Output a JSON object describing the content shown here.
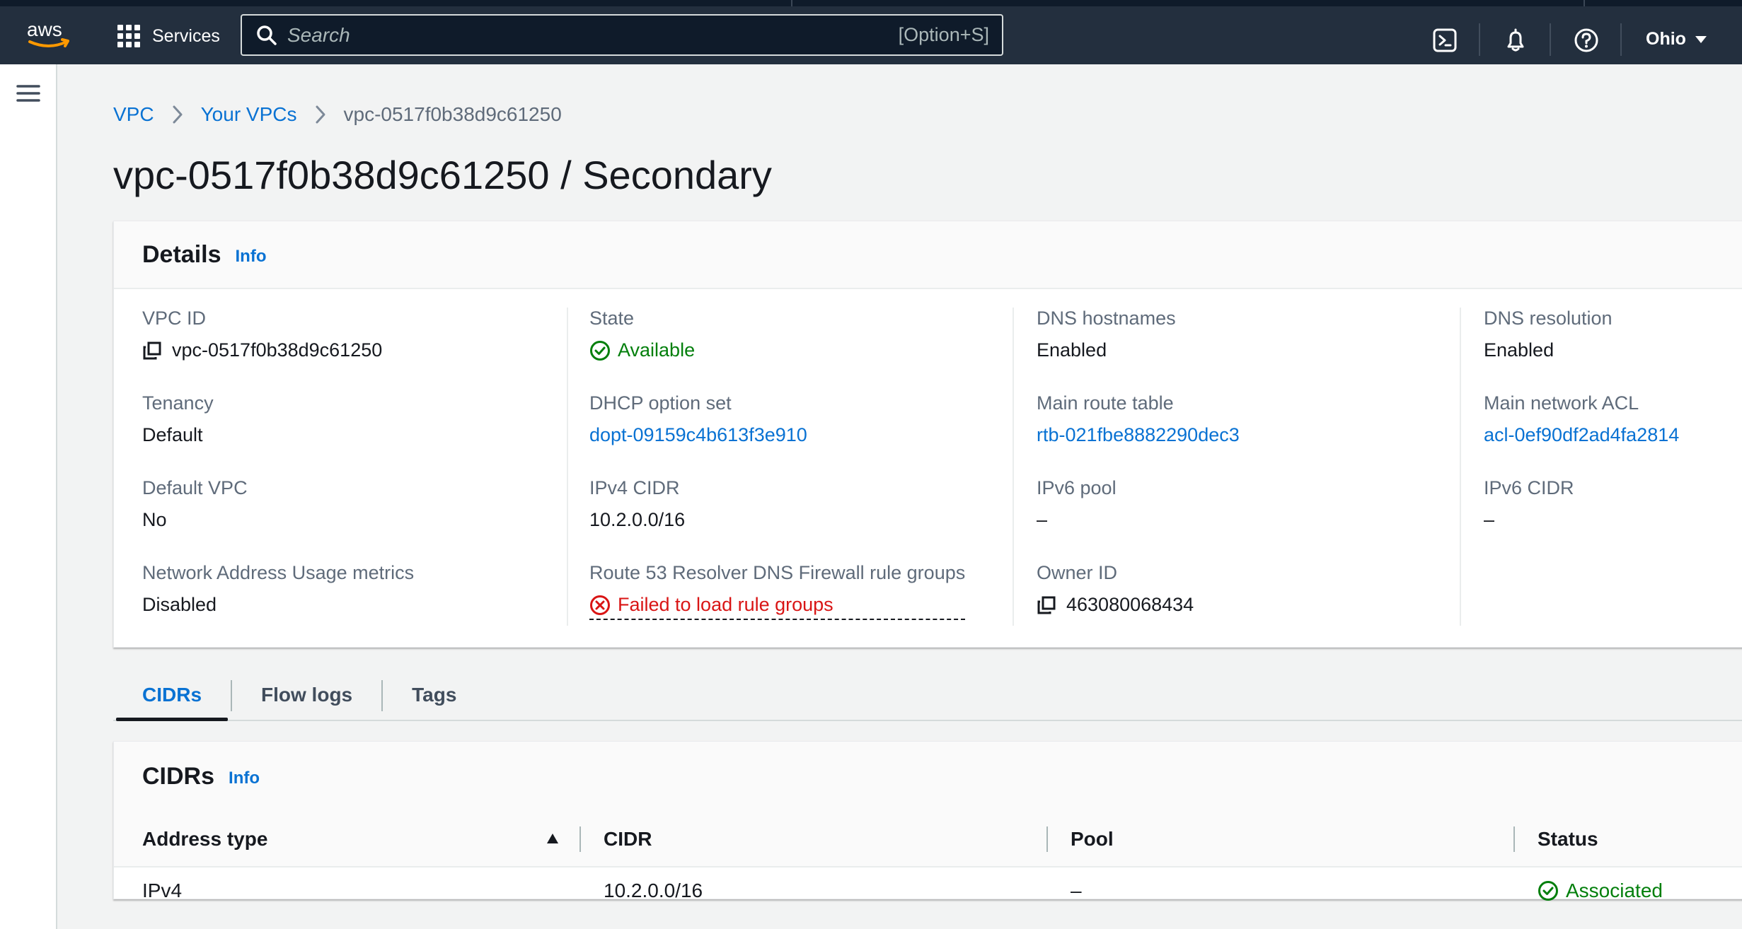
{
  "topnav": {
    "logo": "aws",
    "services_label": "Services",
    "search_placeholder": "Search",
    "search_shortcut": "[Option+S]",
    "icons": [
      "cloudshell-icon",
      "bell-icon",
      "help-icon"
    ],
    "region": "Ohio"
  },
  "breadcrumb": {
    "items": [
      "VPC",
      "Your VPCs"
    ],
    "current": "vpc-0517f0b38d9c61250"
  },
  "page_title": "vpc-0517f0b38d9c61250 / Secondary",
  "details": {
    "title": "Details",
    "info": "Info",
    "fields": {
      "vpc_id": {
        "label": "VPC ID",
        "value": "vpc-0517f0b38d9c61250"
      },
      "tenancy": {
        "label": "Tenancy",
        "value": "Default"
      },
      "default_vpc": {
        "label": "Default VPC",
        "value": "No"
      },
      "nau_metrics": {
        "label": "Network Address Usage metrics",
        "value": "Disabled"
      },
      "state": {
        "label": "State",
        "value": "Available"
      },
      "dhcp": {
        "label": "DHCP option set",
        "value": "dopt-09159c4b613f3e910"
      },
      "ipv4_cidr": {
        "label": "IPv4 CIDR",
        "value": "10.2.0.0/16"
      },
      "r53": {
        "label": "Route 53 Resolver DNS Firewall rule groups",
        "value": "Failed to load rule groups"
      },
      "dns_hostnames": {
        "label": "DNS hostnames",
        "value": "Enabled"
      },
      "main_route_table": {
        "label": "Main route table",
        "value": "rtb-021fbe8882290dec3"
      },
      "ipv6_pool": {
        "label": "IPv6 pool",
        "value": "–"
      },
      "owner_id": {
        "label": "Owner ID",
        "value": "463080068434"
      },
      "dns_resolution": {
        "label": "DNS resolution",
        "value": "Enabled"
      },
      "main_acl": {
        "label": "Main network ACL",
        "value": "acl-0ef90df2ad4fa2814"
      },
      "ipv6_cidr": {
        "label": "IPv6 CIDR",
        "value": "–"
      }
    }
  },
  "tabs": [
    "CIDRs",
    "Flow logs",
    "Tags"
  ],
  "cidrs": {
    "title": "CIDRs",
    "info": "Info",
    "columns": [
      "Address type",
      "CIDR",
      "Pool",
      "Status"
    ],
    "rows": [
      {
        "address_type": "IPv4",
        "cidr": "10.2.0.0/16",
        "pool": "–",
        "status": "Associated"
      }
    ]
  },
  "colors": {
    "nav_bg": "#232f3e",
    "link": "#0972d3",
    "success": "#037f0c",
    "error": "#d91515",
    "aws_orange": "#ff9900"
  }
}
